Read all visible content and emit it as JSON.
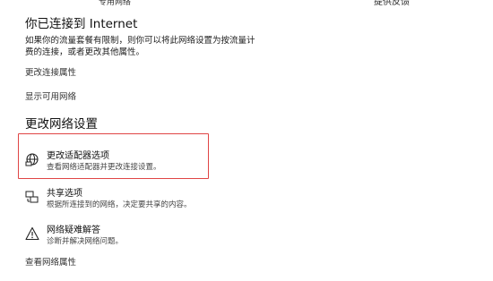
{
  "header": {
    "top_left_cut": "专用网络",
    "feedback_link": "提供反馈"
  },
  "status": {
    "title": "你已连接到 Internet",
    "description_line1": "如果你的流量套餐有限制，则你可以将此网络设置为按流量计",
    "description_line2": "费的连接，或者更改其他属性。",
    "change_connection_properties": "更改连接属性",
    "show_available_networks": "显示可用网络"
  },
  "settings": {
    "title": "更改网络设置",
    "items": [
      {
        "title": "更改适配器选项",
        "description": "查看网络适配器并更改连接设置。",
        "icon": "network-adapter-icon"
      },
      {
        "title": "共享选项",
        "description": "根据所连接到的网络，决定要共享的内容。",
        "icon": "sharing-icon"
      },
      {
        "title": "网络疑难解答",
        "description": "诊断并解决网络问题。",
        "icon": "warning-icon"
      }
    ],
    "view_network_properties": "查看网络属性"
  },
  "colors": {
    "highlight": "#e04545"
  }
}
